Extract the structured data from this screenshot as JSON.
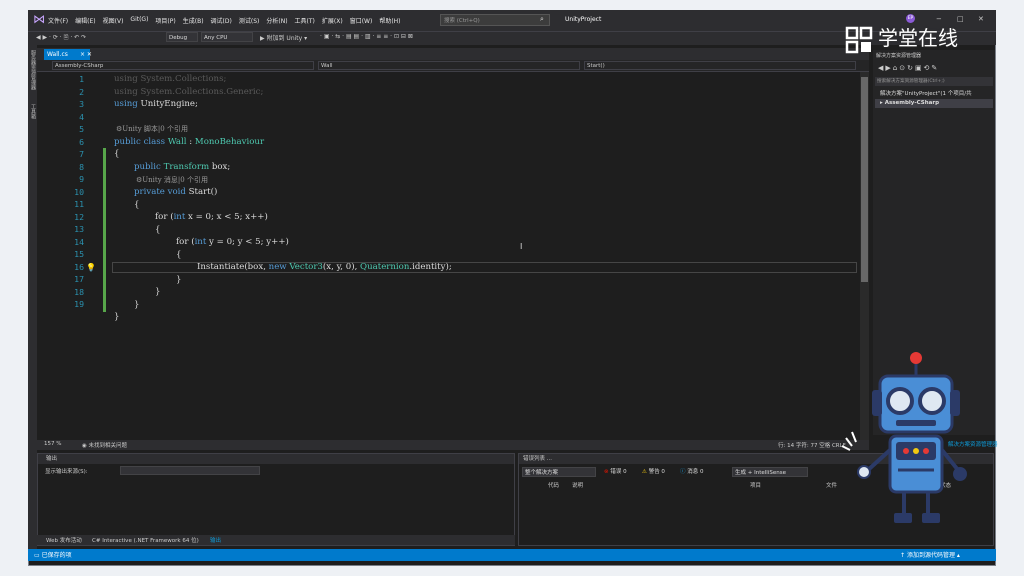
{
  "menu": [
    "文件(F)",
    "编辑(E)",
    "视图(V)",
    "Git(G)",
    "项目(P)",
    "生成(B)",
    "调试(D)",
    "测试(S)",
    "分析(N)",
    "工具(T)",
    "扩展(X)",
    "窗口(W)",
    "帮助(H)"
  ],
  "search": {
    "placeholder": "搜索 (Ctrl+Q)"
  },
  "project_name": "UnityProject",
  "avatar_initials": "EP",
  "toolbar": {
    "config": "Debug",
    "platform": "Any CPU",
    "attach": "▶ 附加到 Unity ▾"
  },
  "left_strip": [
    "服务器资源管理器",
    "工具箱"
  ],
  "tab": {
    "title": "Wall.cs",
    "close": "× ✕"
  },
  "navbar": {
    "project": "Assembly-CSharp",
    "class": "Wall",
    "member": "Start()"
  },
  "code": {
    "line_numbers": [
      "1",
      "2",
      "3",
      "4",
      "5",
      "6",
      "7",
      "8",
      "9",
      "10",
      "11",
      "12",
      "13",
      "14",
      "15",
      "16",
      "17",
      "18",
      "19"
    ],
    "lens1": "⚙Unity 脚本|0 个引用",
    "lens2": "⚙Unity 消息|0 个引用",
    "l1": "using System.Collections;",
    "l2": "using System.Collections.Generic;",
    "l3": "using UnityEngine;",
    "l5a": "public class ",
    "l5b": "Wall",
    "l5c": " : ",
    "l5d": "MonoBehaviour",
    "l6": "{",
    "l7a": "public ",
    "l7b": "Transform",
    "l7c": " box;",
    "l8a": "private void ",
    "l8b": "Start()",
    "l9": "{",
    "l10a": "for (",
    "l10b": "int",
    "l10c": " x = 0; x < 5; x++)",
    "l11": "{",
    "l12a": "for (",
    "l12b": "int",
    "l12c": " y = 0; y < 5; y++)",
    "l13": "{",
    "l14a": "Instantiate(box, ",
    "l14b": "new ",
    "l14c": "Vector3",
    "l14d": "(x, y, 0), ",
    "l14e": "Quaternion",
    "l14f": ".identity);",
    "l15": "}",
    "l16": "}",
    "l17": "}",
    "l18": "}"
  },
  "editor_status": {
    "zoom": "157 %",
    "issues": "◉ 未找到相关问题",
    "position": "行: 14   字符: 77   空格   CRLF"
  },
  "solution_explorer": {
    "title": "解决方案资源管理器",
    "search": "搜索解决方案资源管理器(Ctrl+;)",
    "solution": "解决方案\"UnityProject\"(1 个项目/共",
    "project": "Assembly-CSharp"
  },
  "output": {
    "title": "输出",
    "source_label": "显示输出来源(S):"
  },
  "error_list": {
    "title": "错误列表 ...",
    "scope": "整个解决方案",
    "errors": "错误 0",
    "warnings": "警告 0",
    "messages": "消息 0",
    "build": "生成 + IntelliSense",
    "columns": [
      "代码",
      "说明",
      "项目",
      "文件",
      "状态"
    ]
  },
  "bottom_tabs": [
    "Web 发布活动",
    "C# Interactive (.NET Framework 64 位)",
    "输出"
  ],
  "status": {
    "left": "已保存的项",
    "right": "添加到源代码管理 ▴",
    "right_tab": "解决方案资源管理器"
  },
  "watermark": "学堂在线",
  "colors": {
    "accent": "#007acc",
    "keyword": "#569cd6",
    "type": "#4ec9b0",
    "linenum": "#2b91af"
  }
}
